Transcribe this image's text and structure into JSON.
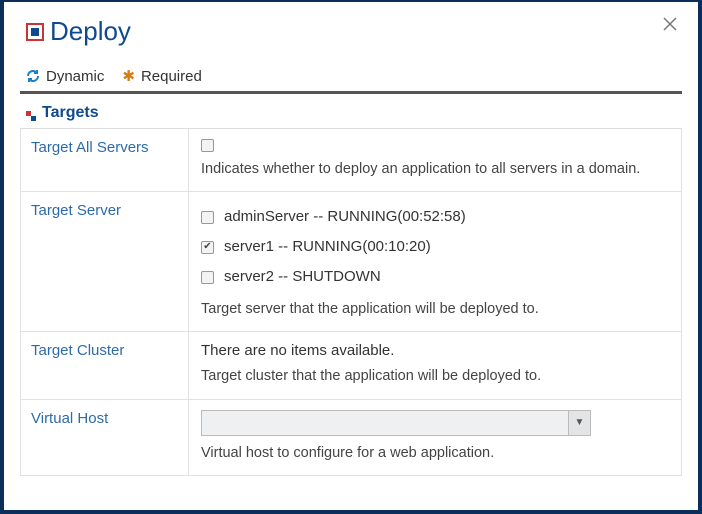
{
  "dialog": {
    "title": "Deploy"
  },
  "legend": {
    "dynamic": "Dynamic",
    "required": "Required"
  },
  "section": {
    "title": "Targets"
  },
  "targetAll": {
    "label": "Target All Servers",
    "checked": false,
    "help": "Indicates whether to deploy an application to all servers in a domain."
  },
  "targetServer": {
    "label": "Target Server",
    "servers": [
      {
        "label": "adminServer -- RUNNING(00:52:58)",
        "checked": false
      },
      {
        "label": "server1 -- RUNNING(00:10:20)",
        "checked": true
      },
      {
        "label": "server2 -- SHUTDOWN",
        "checked": false
      }
    ],
    "help": "Target server that the application will be deployed to."
  },
  "targetCluster": {
    "label": "Target Cluster",
    "emptyMessage": "There are no items available.",
    "help": "Target cluster that the application will be deployed to."
  },
  "virtualHost": {
    "label": "Virtual Host",
    "selected": "",
    "help": "Virtual host to configure for a web application."
  }
}
